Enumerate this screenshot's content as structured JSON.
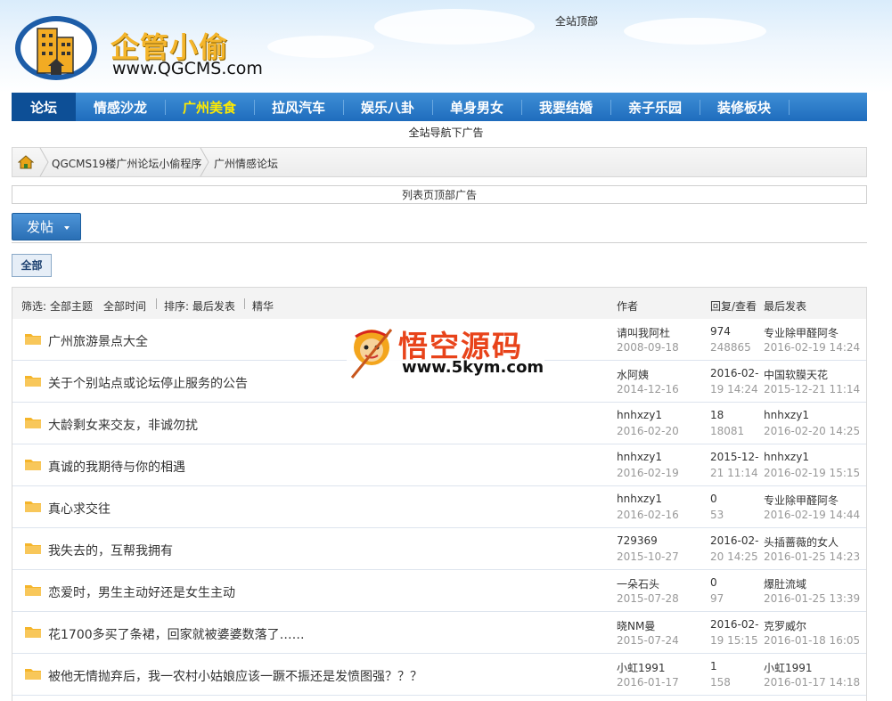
{
  "brand": {
    "name": "企管小偷",
    "url": "www.QGCMS.com"
  },
  "ads": {
    "top": "全站顶部",
    "below_nav": "全站导航下广告",
    "list_top": "列表页顶部广告"
  },
  "nav": [
    {
      "label": "论坛",
      "state": "active"
    },
    {
      "label": "情感沙龙",
      "state": ""
    },
    {
      "label": "广州美食",
      "state": "highlight"
    },
    {
      "label": "拉风汽车",
      "state": ""
    },
    {
      "label": "娱乐八卦",
      "state": ""
    },
    {
      "label": "单身男女",
      "state": ""
    },
    {
      "label": "我要结婚",
      "state": ""
    },
    {
      "label": "亲子乐园",
      "state": ""
    },
    {
      "label": "装修板块",
      "state": ""
    }
  ],
  "breadcrumb": [
    "QGCMS19楼广州论坛小偷程序",
    "广州情感论坛"
  ],
  "post_button": "发帖",
  "filter_tab": "全部",
  "list_header": {
    "filter_label": "筛选:",
    "all_threads": "全部主题",
    "all_time": "全部时间",
    "sort": "排序: 最后发表",
    "essence": "精华",
    "author": "作者",
    "reply_view": "回复/查看",
    "last_post": "最后发表"
  },
  "threads": [
    {
      "title": "广州旅游景点大全",
      "author": "请叫我阿杜",
      "date": "2008-09-18",
      "n1": "974",
      "n2": "248865",
      "last_user": "专业除甲醛阿冬",
      "last_time": "2016-02-19 14:24"
    },
    {
      "title": "关于个别站点或论坛停止服务的公告",
      "author": "水阿姨",
      "date": "2014-12-16",
      "n1": "2016-02-",
      "n2": "19 14:24",
      "last_user": "中国软膜天花",
      "last_time": "2015-12-21 11:14"
    },
    {
      "title": "大龄剩女来交友，非诚勿扰",
      "author": "hnhxzy1",
      "date": "2016-02-20",
      "n1": "18",
      "n2": "18081",
      "last_user": "hnhxzy1",
      "last_time": "2016-02-20 14:25"
    },
    {
      "title": "真诚的我期待与你的相遇",
      "author": "hnhxzy1",
      "date": "2016-02-19",
      "n1": "2015-12-",
      "n2": "21 11:14",
      "last_user": "hnhxzy1",
      "last_time": "2016-02-19 15:15"
    },
    {
      "title": "真心求交往",
      "author": "hnhxzy1",
      "date": "2016-02-16",
      "n1": "0",
      "n2": "53",
      "last_user": "专业除甲醛阿冬",
      "last_time": "2016-02-19 14:44"
    },
    {
      "title": "我失去的，互帮我拥有",
      "author": "729369",
      "date": "2015-10-27",
      "n1": "2016-02-",
      "n2": "20 14:25",
      "last_user": "头插蔷薇的女人",
      "last_time": "2016-01-25 14:23"
    },
    {
      "title": "恋爱时，男生主动好还是女生主动",
      "author": "一朵石头",
      "date": "2015-07-28",
      "n1": "0",
      "n2": "97",
      "last_user": "爆肚流域",
      "last_time": "2016-01-25 13:39"
    },
    {
      "title": "花1700多买了条裙，回家就被婆婆数落了……",
      "author": "晓NM曼",
      "date": "2015-07-24",
      "n1": "2016-02-",
      "n2": "19 15:15",
      "last_user": "克罗威尔",
      "last_time": "2016-01-18 16:05"
    },
    {
      "title": "被他无情抛弃后，我一农村小姑娘应该一蹶不振还是发愤图强？？？",
      "author": "小虹1991",
      "date": "2016-01-17",
      "n1": "1",
      "n2": "158",
      "last_user": "小虹1991",
      "last_time": "2016-01-17 14:18"
    }
  ],
  "watermark": {
    "title": "悟空源码",
    "url": "www.5kym.com"
  },
  "colors": {
    "nav_bg": "#2a78c6",
    "nav_active": "#0d4f96",
    "nav_highlight": "#ffea00",
    "folder": "#f5b52a"
  }
}
